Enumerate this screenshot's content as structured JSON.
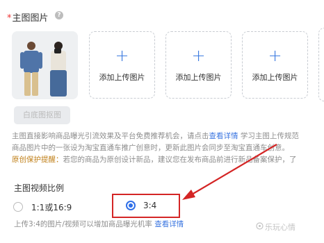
{
  "main_image": {
    "required_mark": "*",
    "title": "主图图片",
    "help_glyph": "?",
    "upload_plus": "+",
    "upload_slots": [
      "添加上传图片",
      "添加上传图片",
      "添加上传图片"
    ],
    "white_bg_button": "白底图抠图",
    "desc_line1_a": "主图直接影响商品曝光引流效果及平台免费推荐机会，请点击",
    "desc_line1_link": "查看详情",
    "desc_line1_b": " 学习主图上传规范",
    "desc_line2": "商品图片中的一张设为淘宝直通车推广创意时，更新此图片会同步至淘宝直通车创意。",
    "desc_line3_warn": "原创保护提醒：",
    "desc_line3_rest": "若您的商品为原创设计新品，建议您在发布商品前进行新品备案保护，了"
  },
  "video_ratio": {
    "title": "主图视频比例",
    "options": [
      {
        "label": "1:1或16:9",
        "selected": false
      },
      {
        "label": "3:4",
        "selected": true
      }
    ],
    "note_text": "上传3:4的图片/视频可以增加商品曝光机率 ",
    "note_link": "查看详情"
  },
  "watermark": "乐玩心情",
  "colors": {
    "accent": "#2f6fe8",
    "link": "#3b76e0",
    "annotation_red": "#d42525",
    "warning": "#c0801a"
  }
}
